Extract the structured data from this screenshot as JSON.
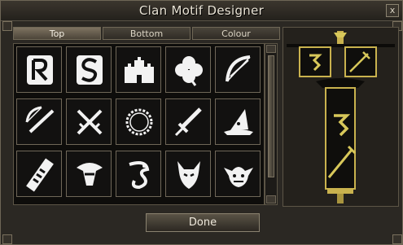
{
  "window": {
    "title": "Clan Motif Designer",
    "close_label": "x"
  },
  "tabs": [
    {
      "label": "Top",
      "active": true
    },
    {
      "label": "Bottom",
      "active": false
    },
    {
      "label": "Colour",
      "active": false
    }
  ],
  "motifs": [
    {
      "icon": "rune-r-icon"
    },
    {
      "icon": "rune-s-icon"
    },
    {
      "icon": "castle-icon"
    },
    {
      "icon": "clover-icon"
    },
    {
      "icon": "bow-icon"
    },
    {
      "icon": "crossbow-icon"
    },
    {
      "icon": "crossed-swords-icon"
    },
    {
      "icon": "ring-icon"
    },
    {
      "icon": "sword-icon"
    },
    {
      "icon": "wizard-hat-icon"
    },
    {
      "icon": "scroll-icon"
    },
    {
      "icon": "helmet-icon"
    },
    {
      "icon": "dragon-icon"
    },
    {
      "icon": "demon-icon"
    },
    {
      "icon": "goblin-icon"
    }
  ],
  "preview": {
    "top_icon": "rune-icon",
    "bottom_icon": "staff-icon",
    "banner_icon": "rune-icon"
  },
  "done_label": "Done",
  "colors": {
    "accent": "#d8c85a",
    "frame": "#6e6656",
    "panel": "#2b2823"
  }
}
